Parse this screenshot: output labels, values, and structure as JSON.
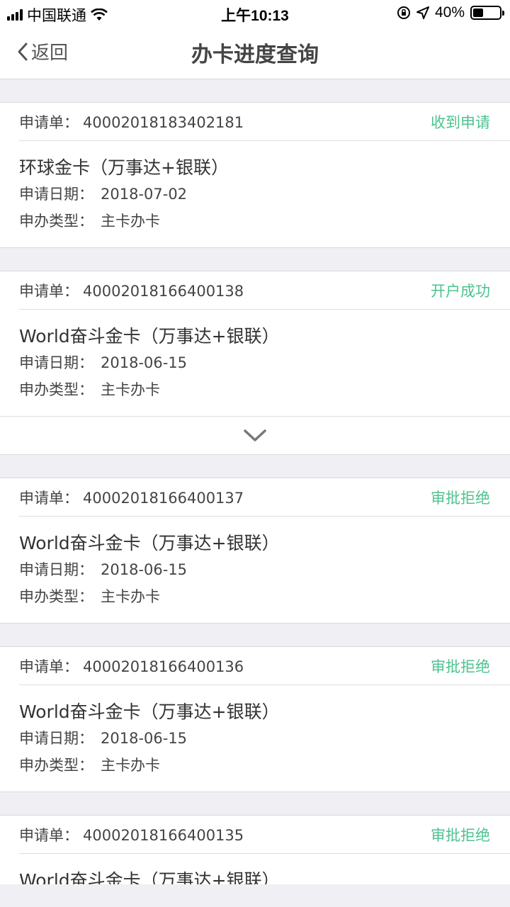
{
  "status_bar": {
    "carrier": "中国联通",
    "time": "上午10:13",
    "battery": "40%",
    "battery_level": 0.4
  },
  "nav": {
    "back_label": "返回",
    "title": "办卡进度查询"
  },
  "labels": {
    "application_no": "申请单：",
    "apply_date": "申请日期：",
    "apply_type": "申办类型："
  },
  "applications": [
    {
      "number": "40002018183402181",
      "status": "收到申请",
      "card_name": "环球金卡（万事达+银联）",
      "date": "2018-07-02",
      "type": "主卡办卡"
    },
    {
      "number": "40002018166400138",
      "status": "开户成功",
      "card_name": "World奋斗金卡（万事达+银联）",
      "date": "2018-06-15",
      "type": "主卡办卡"
    },
    {
      "number": "40002018166400137",
      "status": "审批拒绝",
      "card_name": "World奋斗金卡（万事达+银联）",
      "date": "2018-06-15",
      "type": "主卡办卡"
    },
    {
      "number": "40002018166400136",
      "status": "审批拒绝",
      "card_name": "World奋斗金卡（万事达+银联）",
      "date": "2018-06-15",
      "type": "主卡办卡"
    },
    {
      "number": "40002018166400135",
      "status": "审批拒绝",
      "card_name": "World奋斗金卡（万事达+银联）",
      "date": "",
      "type": ""
    }
  ],
  "colors": {
    "status_green": "#4cc28f",
    "background": "#efeff4"
  }
}
